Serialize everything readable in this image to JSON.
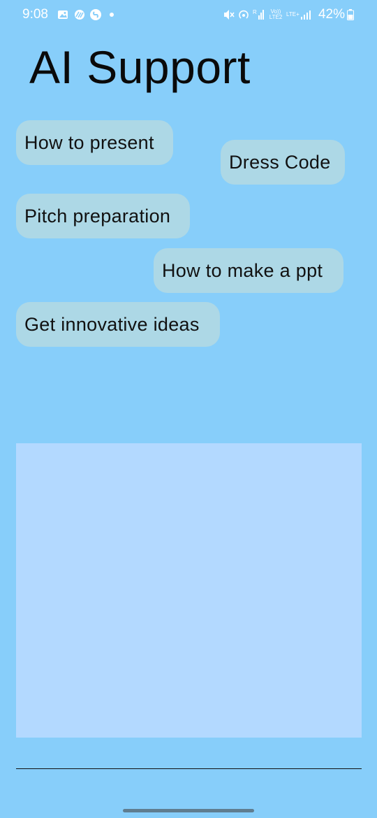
{
  "status_bar": {
    "time": "9:08",
    "battery": "42%",
    "left_icons": [
      "gallery-icon",
      "media-icon",
      "shazam-icon",
      "dot-icon"
    ],
    "right_icons": [
      "mute-icon",
      "hotspot-icon",
      "signal-r-icon",
      "volte-icon",
      "lte-icon",
      "signal-icon",
      "battery-icon"
    ],
    "volte_label": "Vo)) LTE2",
    "lte_label": "LTE+"
  },
  "page": {
    "title": "AI Support"
  },
  "suggestions": [
    {
      "label": "How to present"
    },
    {
      "label": "Dress Code"
    },
    {
      "label": "Pitch preparation"
    },
    {
      "label": "How to make a ppt"
    },
    {
      "label": "Get innovative ideas"
    }
  ],
  "input": {
    "value": "",
    "placeholder": ""
  },
  "colors": {
    "background": "#87CEFA",
    "chip": "#ADD8E6",
    "response_area": "#B3D9FF",
    "text": "#111111"
  }
}
